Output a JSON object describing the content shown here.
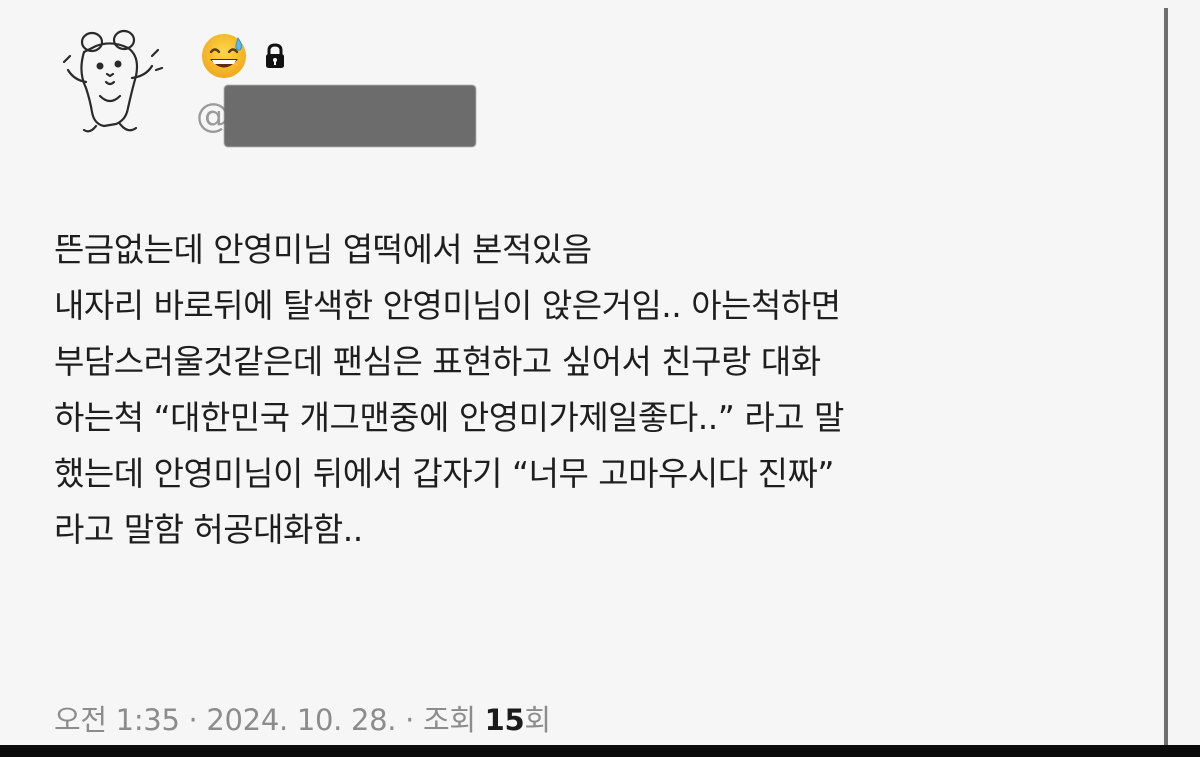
{
  "profile": {
    "avatar_icon": "hamster-sketch-avatar-icon",
    "emoji_icon": "grinning-sweat-emoji-icon",
    "lock_icon": "lock-icon",
    "handle_prefix": "@",
    "handle_redacted": true
  },
  "post": {
    "lines": [
      "뜬금없는데 안영미님 엽떡에서 본적있음",
      "내자리 바로뒤에 탈색한 안영미님이 앉은거임.. 아는척하면",
      "부담스러울것같은데 팬심은 표현하고 싶어서 친구랑 대화",
      "하는척 “대한민국 개그맨중에 안영미가제일좋다..” 라고 말",
      "했는데 안영미님이 뒤에서 갑자기 “너무 고마우시다 진짜”",
      "라고 말함 허공대화함.."
    ]
  },
  "meta": {
    "time": "오전 1:35",
    "separator": "·",
    "date": "2024. 10. 28.",
    "views_label": "조회",
    "views_count": "15",
    "views_suffix": "회"
  },
  "colors": {
    "background": "#f6f6f6",
    "text": "#1e1e1e",
    "meta_text": "#8c8c8c",
    "redaction": "#6c6c6c"
  }
}
